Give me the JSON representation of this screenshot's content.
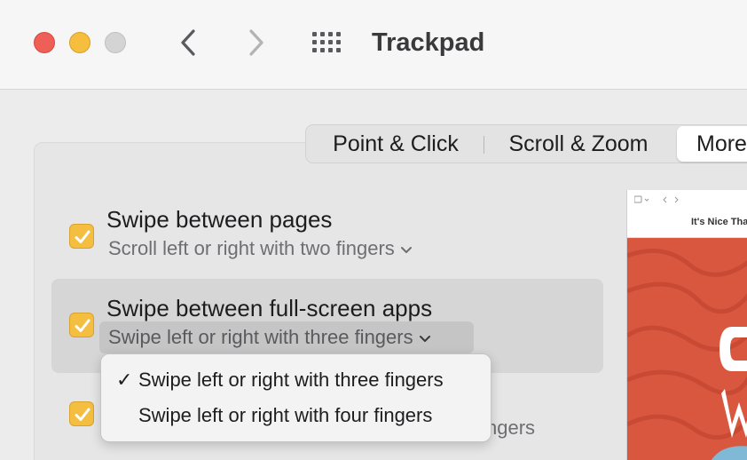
{
  "window": {
    "title": "Trackpad"
  },
  "tabs": [
    {
      "label": "Point & Click"
    },
    {
      "label": "Scroll & Zoom"
    },
    {
      "label": "More Gestures"
    }
  ],
  "tabs_visible": {
    "point": "Point & Click",
    "scroll": "Scroll & Zoom",
    "more": "More"
  },
  "settings": [
    {
      "title": "Swipe between pages",
      "option": "Scroll left or right with two fingers",
      "checked": true
    },
    {
      "title": "Swipe between full-screen apps",
      "option": "Swipe left or right with three fingers",
      "checked": true
    },
    {
      "title": "",
      "option_fragment": "ngers",
      "checked": true
    }
  ],
  "dropdown": {
    "options": [
      {
        "label": "Swipe left or right with three fingers",
        "selected": true
      },
      {
        "label": "Swipe left or right with four fingers",
        "selected": false
      }
    ],
    "check_mark": "✓"
  },
  "preview": {
    "site_name": "It's Nice That"
  },
  "colors": {
    "checkbox": "#f4bf40",
    "close": "#ee5f57",
    "minimize": "#f6be3f",
    "zoom": "#d4d4d4",
    "preview_accent": "#d9573f"
  },
  "icons": {
    "back": "chevron-left-icon",
    "forward": "chevron-right-icon",
    "grid": "grid-icon",
    "checkmark": "checkmark-icon",
    "popup_chevron": "chevron-down-icon"
  }
}
